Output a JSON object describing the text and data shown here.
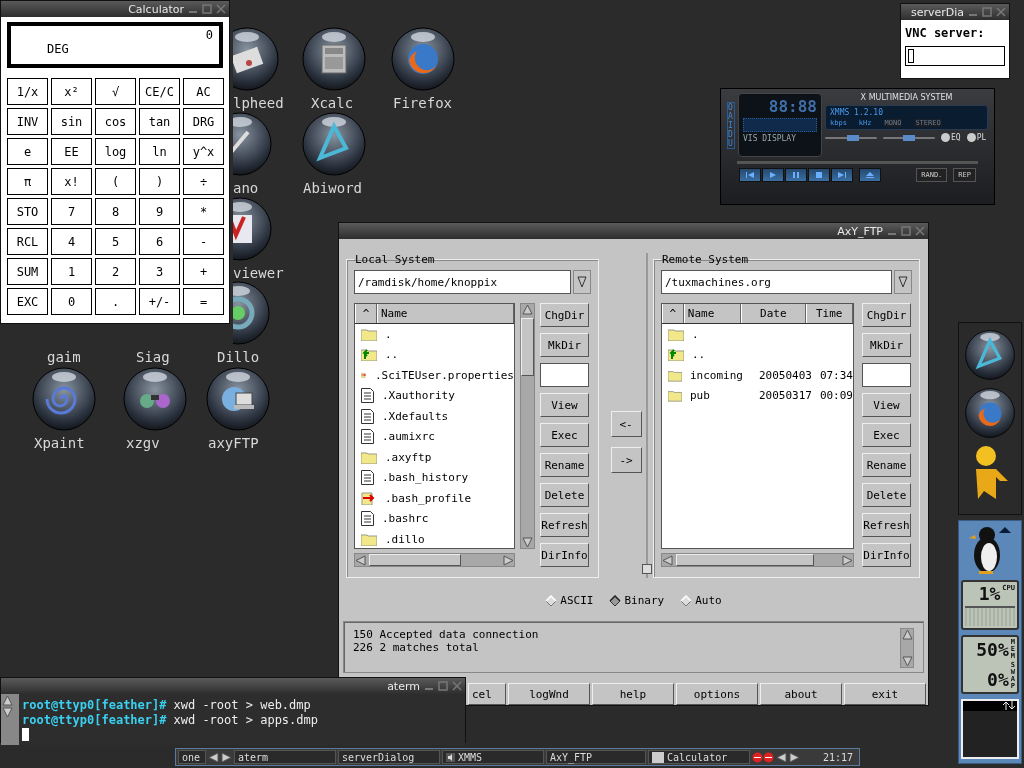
{
  "calculator": {
    "title": "Calculator",
    "display": "0",
    "mode": "DEG",
    "keys": [
      "1/x",
      "x²",
      "√",
      "CE/C",
      "AC",
      "INV",
      "sin",
      "cos",
      "tan",
      "DRG",
      "e",
      "EE",
      "log",
      "ln",
      "y^x",
      "π",
      "x!",
      "(",
      ")",
      "÷",
      "STO",
      "7",
      "8",
      "9",
      "*",
      "RCL",
      "4",
      "5",
      "6",
      "-",
      "SUM",
      "1",
      "2",
      "3",
      "+",
      "EXC",
      "0",
      ".",
      "+/-",
      "="
    ]
  },
  "desktop_icons": [
    {
      "label": "lpheed"
    },
    {
      "label": "Xcalc"
    },
    {
      "label": "Firefox"
    },
    {
      "label": "ano"
    },
    {
      "label": "Abiword"
    },
    {
      "label": "viewer"
    },
    {
      "label": "gaim"
    },
    {
      "label": "Siag"
    },
    {
      "label": "Dillo"
    },
    {
      "label": "Xpaint"
    },
    {
      "label": "xzgv"
    },
    {
      "label": "axyFTP"
    }
  ],
  "server_dialog": {
    "title": "serverDia",
    "label": "VNC server:"
  },
  "xmms": {
    "title": "X MULTIMEDIA SYSTEM",
    "side_label": "OAIDU",
    "time": "88:88",
    "vis_label": "VIS DISPLAY",
    "song": "XMMS 1.2.10",
    "kbps": "kbps",
    "khz": "kHz",
    "mono": "MONO",
    "stereo": "STEREO",
    "volume": {
      "level": 0.54
    },
    "balance": {
      "level": 0.5
    },
    "eq": "EQ",
    "pl": "PL",
    "rand": "RAND.",
    "rep": "REP"
  },
  "ftp": {
    "title": "AxY_FTP",
    "local": {
      "title": "Local System",
      "path": "/ramdisk/home/knoppix",
      "sort": "^",
      "column": "Name",
      "files": [
        {
          "name": ".",
          "kind": "folder"
        },
        {
          "name": "..",
          "kind": "parent"
        },
        {
          "name": ".SciTEUser.properties",
          "kind": "linked"
        },
        {
          "name": ".Xauthority",
          "kind": "file"
        },
        {
          "name": ".Xdefaults",
          "kind": "file"
        },
        {
          "name": ".aumixrc",
          "kind": "file"
        },
        {
          "name": ".axyftp",
          "kind": "folder"
        },
        {
          "name": ".bash_history",
          "kind": "file"
        },
        {
          "name": ".bash_profile",
          "kind": "linked"
        },
        {
          "name": ".bashrc",
          "kind": "file"
        },
        {
          "name": ".dillo",
          "kind": "folder"
        }
      ],
      "buttons": [
        "ChgDir",
        "MkDir",
        "View",
        "Exec",
        "Rename",
        "Delete",
        "Refresh",
        "DirInfo"
      ]
    },
    "remote": {
      "title": "Remote System",
      "path": "/tuxmachines.org",
      "sort": "^",
      "columns": [
        "Name",
        "Date",
        "Time"
      ],
      "files": [
        {
          "name": ".",
          "kind": "folder"
        },
        {
          "name": "..",
          "kind": "parent"
        },
        {
          "name": "incoming",
          "date": "20050403",
          "time": "07:34",
          "kind": "folder"
        },
        {
          "name": "pub",
          "date": "20050317",
          "time": "00:09",
          "kind": "folder"
        }
      ],
      "buttons": [
        "ChgDir",
        "MkDir",
        "View",
        "Exec",
        "Rename",
        "Delete",
        "Refresh",
        "DirInfo"
      ]
    },
    "transfer_buttons": [
      "<-",
      "->"
    ],
    "modes": [
      {
        "label": "ASCII",
        "selected": false
      },
      {
        "label": "Binary",
        "selected": true
      },
      {
        "label": "Auto",
        "selected": false
      }
    ],
    "log": [
      "150 Accepted data connection",
      "226 2 matches total"
    ],
    "bottom_buttons": [
      "cel",
      "logWnd",
      "help",
      "options",
      "about",
      "exit"
    ]
  },
  "terminal": {
    "title": "aterm",
    "lines": [
      {
        "prompt": "root@ttyp0[feather]#",
        "command": "xwd -root > web.dmp"
      },
      {
        "prompt": "root@ttyp0[feather]#",
        "command": "xwd -root > apps.dmp"
      }
    ]
  },
  "taskbar": {
    "desktop": "one",
    "tasks": [
      {
        "label": "aterm",
        "kind": "plain"
      },
      {
        "label": "serverDialog",
        "kind": "plain"
      },
      {
        "label": "XMMS",
        "kind": "media"
      },
      {
        "label": "AxY_FTP",
        "kind": "plain"
      },
      {
        "label": "Calculator",
        "kind": "window"
      }
    ],
    "clock": "21:17"
  },
  "monitors": [
    {
      "label": "CPU",
      "reading": "1%"
    },
    {
      "label": "MEM",
      "reading": "50%"
    },
    {
      "label": "SWAP",
      "reading": "0%"
    }
  ]
}
